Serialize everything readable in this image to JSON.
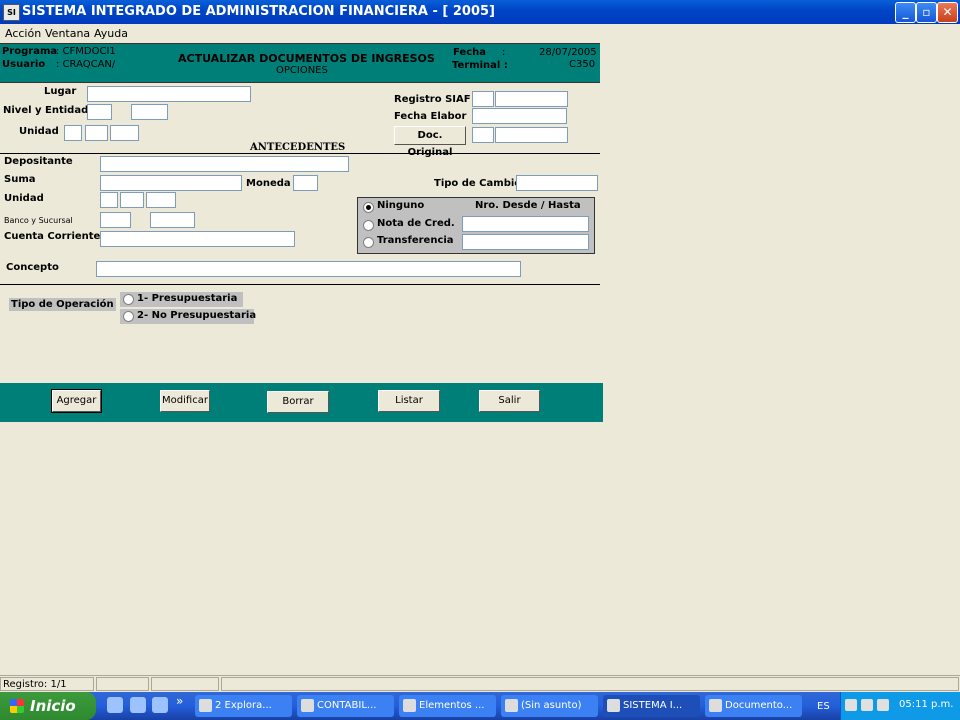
{
  "window": {
    "title": "SISTEMA INTEGRADO DE ADMINISTRACION FINANCIERA - [ 2005]",
    "app_icon_text": "SI",
    "minimize": "_",
    "maximize": "▫",
    "close": "✕"
  },
  "menu": [
    "Acción",
    "Ventana",
    "Ayuda"
  ],
  "header": {
    "programa_label": "Programa",
    "programa_value": ": CFMDOCI1",
    "usuario_label": "Usuario",
    "usuario_value": ": CRAQCAN/",
    "title": "ACTUALIZAR DOCUMENTOS DE INGRESOS",
    "subtitle": "OPCIONES",
    "fecha_label": "Fecha",
    "fecha_sep": ":",
    "fecha_value": "28/07/2005",
    "terminal_label": "Terminal :",
    "terminal_value": "C350"
  },
  "form": {
    "lugar": "Lugar",
    "nivel_entidad": "Nivel y Entidad",
    "unidad": "Unidad",
    "registro_siaf": "Registro SIAF",
    "fecha_elabor": "Fecha Elabor",
    "doc_original": "Doc. Original",
    "antecedentes": "ANTECEDENTES",
    "depositante": "Depositante",
    "suma": "Suma",
    "moneda": "Moneda",
    "tipo_cambio": "Tipo de Cambio",
    "unidad2": "Unidad",
    "banco_sucursal": "Banco y Sucursal",
    "cuenta_corriente": "Cuenta Corriente",
    "concepto": "Concepto",
    "group": {
      "ninguno": "Ninguno",
      "nota_credito": "Nota de Cred.",
      "transferencia": "Transferencia",
      "nro_desde_hasta": "Nro. Desde / Hasta",
      "selected": "Ninguno"
    },
    "tipo_operacion": "Tipo de Operación",
    "op1": "1- Presupuestaria",
    "op2": "2- No Presupuestaria"
  },
  "buttons": {
    "agregar": "Agregar",
    "modificar": "Modificar",
    "borrar": "Borrar",
    "listar": "Listar",
    "salir": "Salir"
  },
  "status": {
    "registro": "Registro: 1/1"
  },
  "taskbar": {
    "start": "Inicio",
    "quicklaunch_more": "»",
    "tasks": [
      "2 Explora...",
      "CONTABIL...",
      "Elementos ...",
      "(Sin asunto)",
      "SISTEMA I...",
      "Documento..."
    ],
    "active_task": "SISTEMA I...",
    "lang": "ES",
    "clock": "05:11 p.m."
  }
}
